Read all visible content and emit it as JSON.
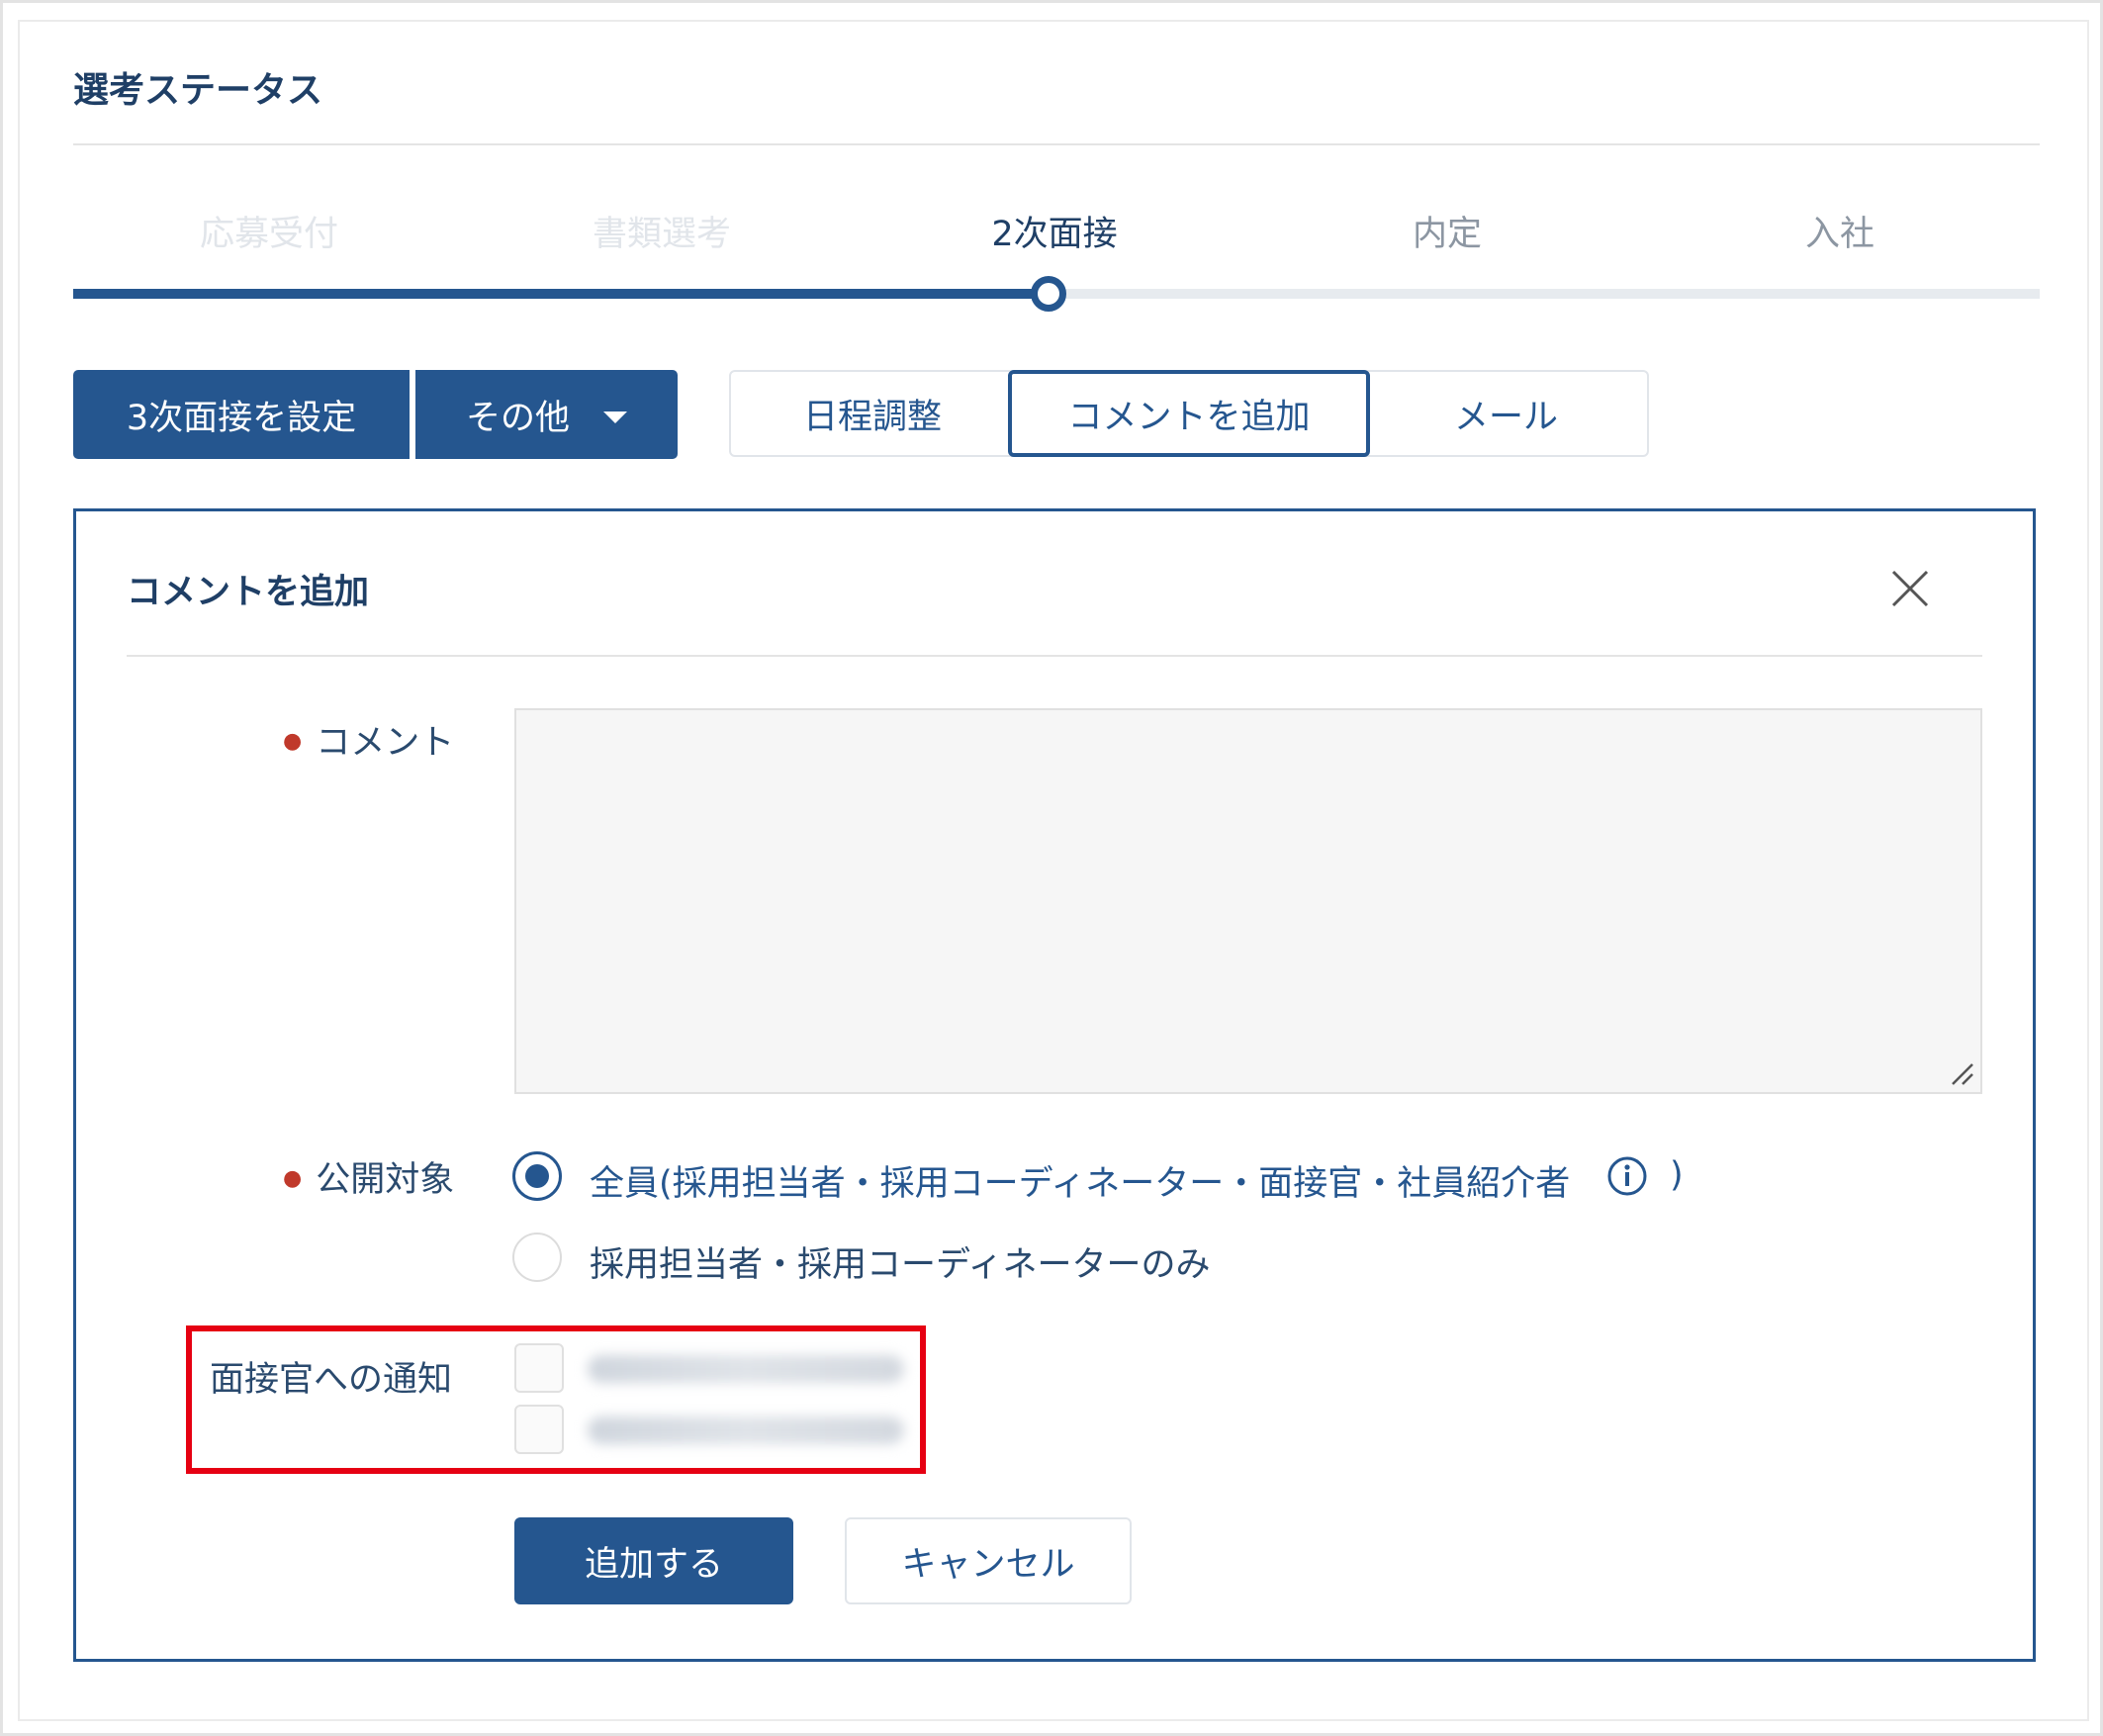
{
  "section_title": "選考ステータス",
  "stepper": {
    "steps": [
      "応募受付",
      "書類選考",
      "2次面接",
      "内定",
      "入社"
    ],
    "current_index": 2
  },
  "actions": {
    "primary_label": "3次面接を設定",
    "other_label": "その他",
    "tabs": [
      "日程調整",
      "コメントを追加",
      "メール"
    ],
    "active_tab": "コメントを追加"
  },
  "panel": {
    "title": "コメントを追加",
    "comment_label": "コメント",
    "comment_value": "",
    "visibility_label": "公開対象",
    "visibility_options": [
      "全員(採用担当者・採用コーディネーター・面接官・社員紹介者",
      "採用担当者・採用コーディネーターのみ"
    ],
    "visibility_close_paren": ")",
    "selected_visibility_index": 0,
    "notify_label": "面接官への通知",
    "submit_label": "追加する",
    "cancel_label": "キャンセル"
  },
  "colors": {
    "primary": "#25568f",
    "highlight": "#e60012",
    "required": "#c0392b"
  }
}
